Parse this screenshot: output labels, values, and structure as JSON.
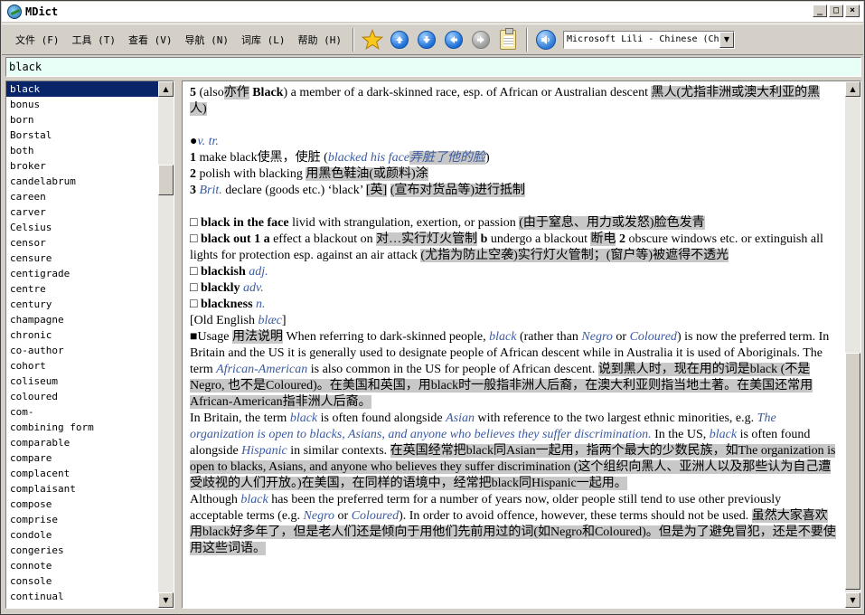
{
  "window": {
    "title": "MDict"
  },
  "menu": [
    "文件 (F)",
    "工具 (T)",
    "查看 (V)",
    "导航 (N)",
    "词库 (L)",
    "帮助 (H)"
  ],
  "voice": {
    "selected": "Microsoft Lili - Chinese (China)"
  },
  "search": {
    "value": "black"
  },
  "wordlist": [
    "black",
    "bonus",
    "born",
    "Borstal",
    "both",
    "broker",
    "candelabrum",
    "careen",
    "carver",
    "Celsius",
    "censor",
    "censure",
    "centigrade",
    "centre",
    "century",
    "champagne",
    "chronic",
    "co-author",
    "cohort",
    "coliseum",
    "coloured",
    "com-",
    "combining form",
    "comparable",
    "compare",
    "complacent",
    "complaisant",
    "compose",
    "comprise",
    "condole",
    "congeries",
    "connote",
    "console",
    "continual"
  ],
  "entry": {
    "s5": {
      "num": "5",
      "t1": " (also",
      "zh1": "亦作",
      "t2": " ",
      "bword": "Black",
      "t3": ") a member of a dark-skinned race, esp. of African or Australian descent ",
      "zh2": "黑人(尤指非洲或澳大利亚的黑人)"
    },
    "vtr": {
      "bullet": "●",
      "label": "v. tr."
    },
    "s1": {
      "num": "1",
      "t1": " make black",
      "zh1": "使黑，使脏",
      "t2": " (",
      "ex": "blacked his face",
      "zh2": "弄脏了他的脸",
      "t3": ")"
    },
    "s2": {
      "num": "2",
      "t1": " polish with blacking ",
      "zh1": "用黑色鞋油(或颜料)涂"
    },
    "s3": {
      "num": "3",
      "brit": "Brit.",
      "t1": " declare (goods etc.) ‘black’ ",
      "zh1": "[英]",
      "t2": " ",
      "zh2": "(宣布对货品等)进行抵制"
    },
    "p1": {
      "box": "□ ",
      "b": "black in the face",
      "t1": " livid with strangulation, exertion, or passion ",
      "zh1": "(由于窒息、用力或发怒)脸色发青"
    },
    "p2": {
      "box": "□ ",
      "b": "black out 1 a",
      "t1": " effect a blackout on ",
      "zh1": "对…实行灯火管制",
      "t2": " ",
      "b2": "b",
      "t3": " undergo a blackout ",
      "zh2": "断电",
      "t4": " ",
      "b3": "2",
      "t5": " obscure windows etc. or extinguish all lights for protection esp. against an air attack ",
      "zh3": "(尤指为防止空袭)实行灯火管制；(窗户等)被遮得不透光"
    },
    "d1": {
      "box": "□ ",
      "b": "blackish",
      "it": "adj."
    },
    "d2": {
      "box": "□ ",
      "b": "blackly",
      "it": "adv."
    },
    "d3": {
      "box": "□ ",
      "b": "blackness",
      "it": "n."
    },
    "etym": {
      "t1": "[Old English ",
      "it": "blæc",
      "t2": "]"
    },
    "usage": {
      "head": "■Usage ",
      "zh0": "用法说明",
      "a1": " When referring to dark-skinned people, ",
      "i1": "black",
      "a2": " (rather than ",
      "i2": "Negro",
      "a3": " or ",
      "i3": "Coloured",
      "a4": ") is now the preferred term. In Britain and the US it is generally used to designate people of African descent while in Australia it is used of Aboriginals. The term ",
      "i4": "African-American",
      "a5": " is also common in the US for people of African descent. ",
      "zh1": "说到黑人时，现在用的词是black (不是Negro, 也不是Coloured)。在美国和英国，用black时一般指非洲人后裔，在澳大利亚则指当地土著。在美国还常用African-American指非洲人后裔。"
    },
    "britain": {
      "a1": "In Britain, the term ",
      "i1": "black",
      "a2": " is often found alongside ",
      "i2": "Asian",
      "a3": " with reference to the two largest ethnic minorities, e.g. ",
      "i3": "The organization is open to blacks, Asians, and anyone who believes they suffer discrimination.",
      "a4": " In the US, ",
      "i4": "black",
      "a5": " is often found alongside ",
      "i5": "Hispanic",
      "a6": " in similar contexts. ",
      "zh1": "在英国经常把black同Asian一起用，指两个最大的少数民族，如The organization is open to blacks, Asians, and anyone who believes they suffer discrimination (这个组织向黑人、亚洲人以及那些认为自己遭受歧视的人们开放。)在美国，在同样的语境中，经常把black同Hispanic一起用。"
    },
    "although": {
      "a1": "Although ",
      "i1": "black",
      "a2": " has been the preferred term for a number of years now, older people still tend to use other previously acceptable terms (e.g. ",
      "i2": "Negro",
      "a3": " or ",
      "i3": "Coloured",
      "a4": "). In order to avoid offence, however, these terms should not be used. ",
      "zh1": "虽然大家喜欢用black好多年了，但是老人们还是倾向于用他们先前用过的词(如Negro和Coloured)。但是为了避免冒犯，还是不要使用这些词语。"
    }
  }
}
